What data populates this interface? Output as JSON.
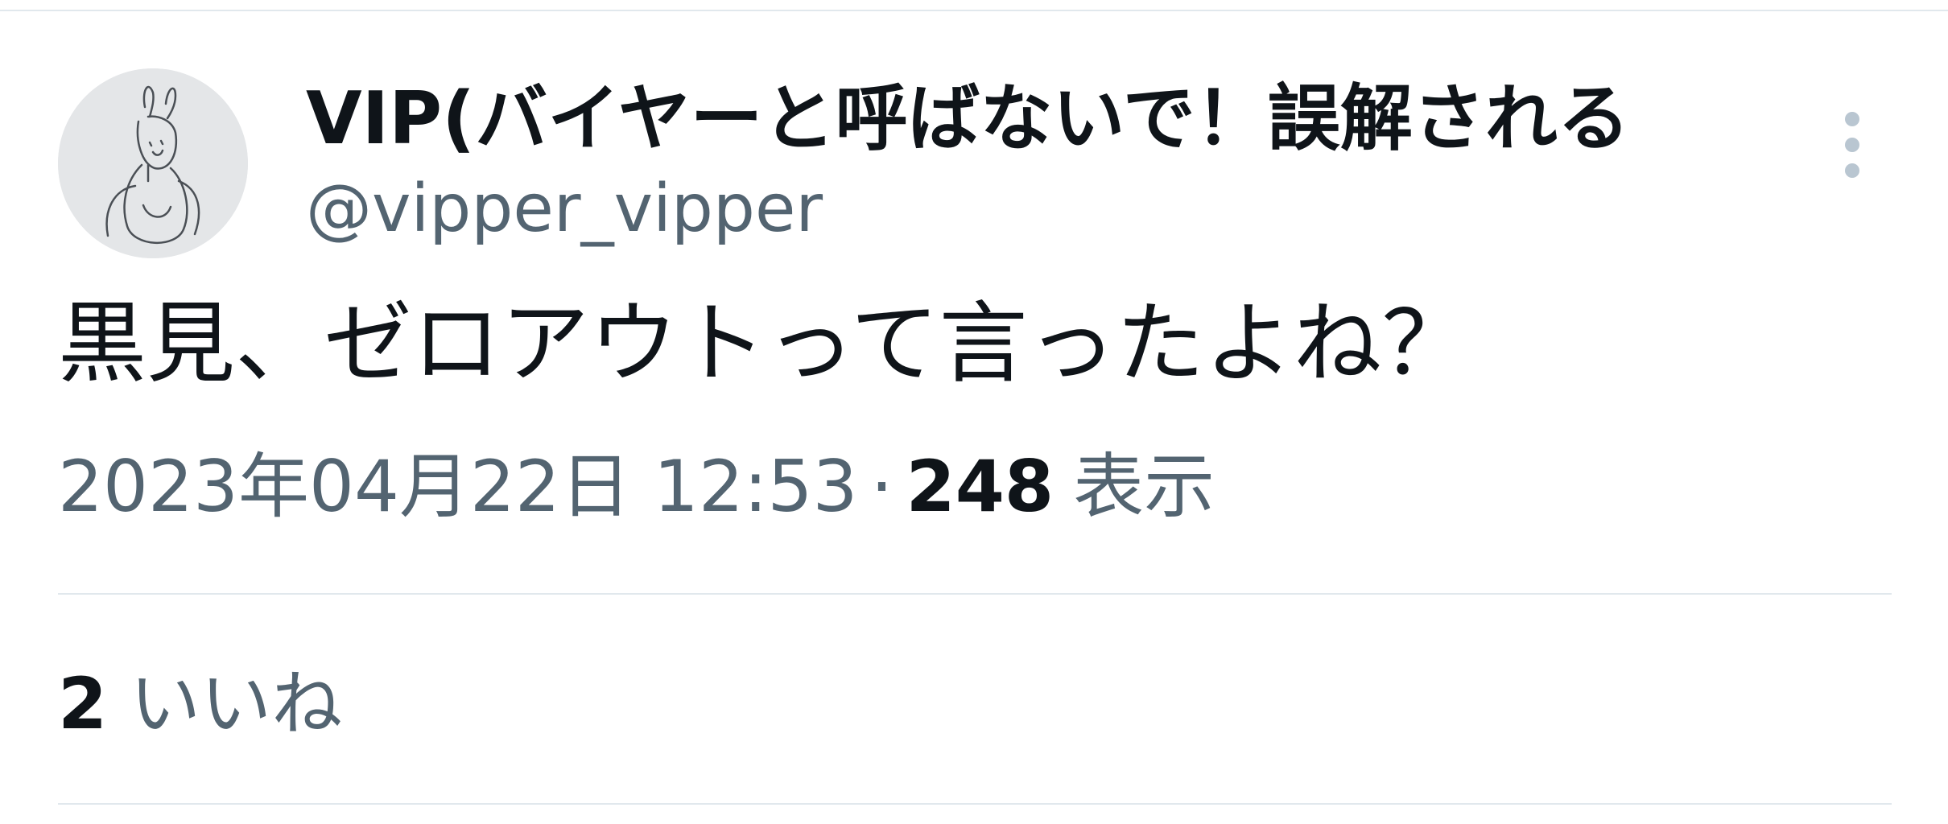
{
  "tweet": {
    "author": {
      "display_name": "VIP(バイヤーと呼ばないで！誤解される",
      "handle": "@vipper_vipper"
    },
    "text": "黒見、ゼロアウトって言ったよね？",
    "timestamp": "2023年04月22日 12:53",
    "separator": "·",
    "views_count": "248",
    "views_label": "表示",
    "likes_count": "2",
    "likes_label": "いいね"
  },
  "icons": {
    "more": "more-vertical-icon",
    "avatar": "avatar-sketch-icon"
  },
  "colors": {
    "primary_text": "#0f1419",
    "secondary_text": "#536471",
    "divider": "#e1e8ed",
    "more_icon": "#b9c6d1"
  }
}
